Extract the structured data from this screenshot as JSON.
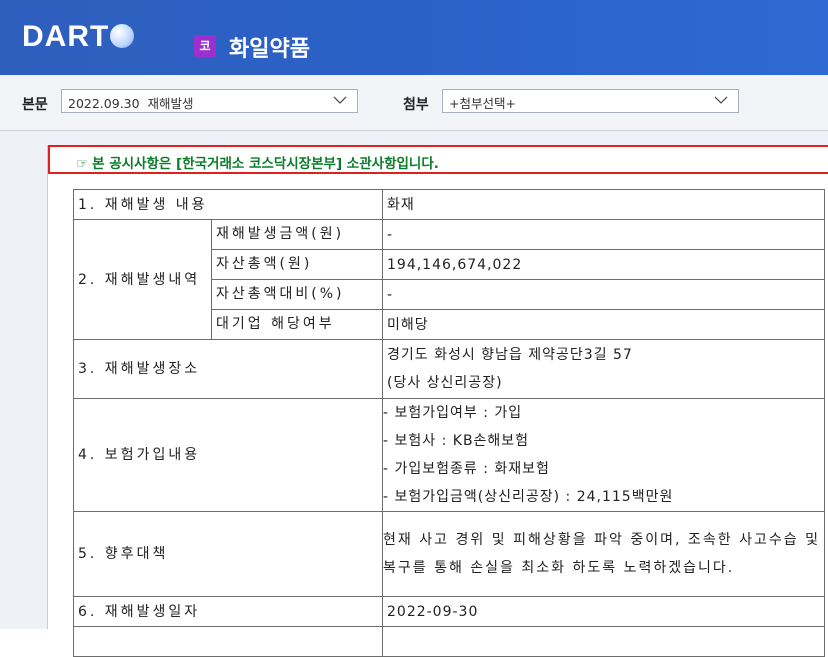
{
  "header": {
    "logo_text": "DART",
    "corp_badge": "코",
    "corp_name": "화일약품"
  },
  "toolbar": {
    "main_label": "본문",
    "main_select_value": "2022.09.30  재해발생",
    "attach_label": "첨부",
    "attach_select_value": "+첨부선택+"
  },
  "notice": {
    "icon": "pointing-hand-icon",
    "text": "본 공시사항은 [한국거래소 코스닥시장본부] 소관사항입니다."
  },
  "table": {
    "row1": {
      "label": "1. 재해발생 내용",
      "value": "화재"
    },
    "row2": {
      "label": "2. 재해발생내역",
      "items": [
        {
          "label": "재해발생금액(원)",
          "value": "-"
        },
        {
          "label": "자산총액(원)",
          "value": "194,146,674,022"
        },
        {
          "label": "자산총액대비(%)",
          "value": "-"
        },
        {
          "label": "대기업 해당여부",
          "value": "미해당"
        }
      ]
    },
    "row3": {
      "label": "3. 재해발생장소",
      "lines": [
        "경기도 화성시 향남읍 제약공단3길 57",
        "(당사 상신리공장)"
      ]
    },
    "row4": {
      "label": "4. 보험가입내용",
      "lines": [
        "- 보험가입여부 : 가입",
        "- 보험사 : KB손해보험",
        "- 가입보험종류 : 화재보험",
        "- 보험가입금액(상신리공장) : 24,115백만원"
      ]
    },
    "row5": {
      "label": "5. 향후대책",
      "value": "현재 사고 경위 및 피해상황을 파악 중이며, 조속한 사고수습 및 복구를 통해 손실을 최소화 하도록 노력하겠습니다."
    },
    "row6": {
      "label": "6. 재해발생일자",
      "value": "2022-09-30"
    }
  }
}
